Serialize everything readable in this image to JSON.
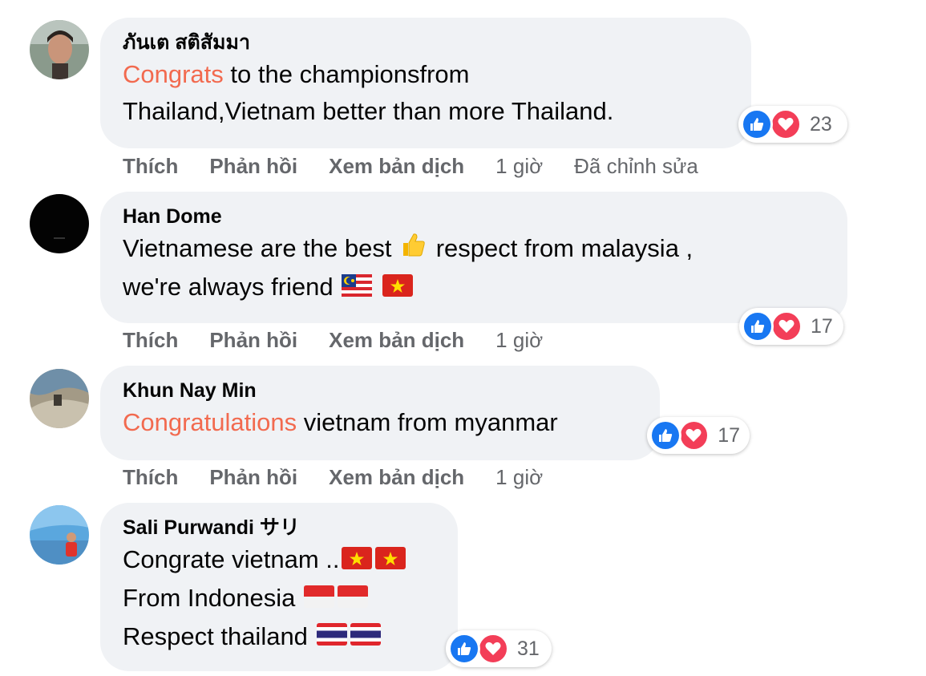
{
  "actions": {
    "like": "Thích",
    "reply": "Phản hồi",
    "translate": "Xem bản dịch"
  },
  "colors": {
    "highlight": "#f26a4f",
    "like_blue": "#1877f2",
    "love_red": "#f33e58",
    "bubble": "#f0f2f5"
  },
  "comments": [
    {
      "author": "ภันเต สติสัมมา",
      "line1_highlight": "Congrats",
      "line1_rest": " to the championsfrom",
      "line2": "Thailand,Vietnam better than more Thailand.",
      "time": "1 giờ",
      "edited": "Đã chỉnh sửa",
      "reaction_count": "23",
      "reaction_icons": [
        "like-icon",
        "love-icon"
      ]
    },
    {
      "author": "Han Dome",
      "line1": "Vietnamese are the best",
      "line1_after": "respect from malaysia ,",
      "line2": "we're always friend",
      "emojis": [
        "thumbs-up-icon",
        "malaysia-flag-icon",
        "vietnam-flag-icon"
      ],
      "time": "1 giờ",
      "reaction_count": "17",
      "reaction_icons": [
        "like-icon",
        "love-icon"
      ]
    },
    {
      "author": "Khun Nay Min",
      "line1_highlight": "Congratulations",
      "line1_rest": " vietnam from myanmar",
      "time": "1 giờ",
      "reaction_count": "17",
      "reaction_icons": [
        "like-icon",
        "love-icon"
      ]
    },
    {
      "author": "Sali Purwandi サリ",
      "line1": "Congrate vietnam ..",
      "line2": "From Indonesia",
      "line3": "Respect thailand",
      "emojis": [
        "vietnam-flag-icon",
        "vietnam-flag-icon",
        "indonesia-flag-icon",
        "indonesia-flag-icon",
        "thailand-flag-icon",
        "thailand-flag-icon"
      ],
      "reaction_count": "31",
      "reaction_icons": [
        "like-icon",
        "love-icon"
      ]
    }
  ]
}
